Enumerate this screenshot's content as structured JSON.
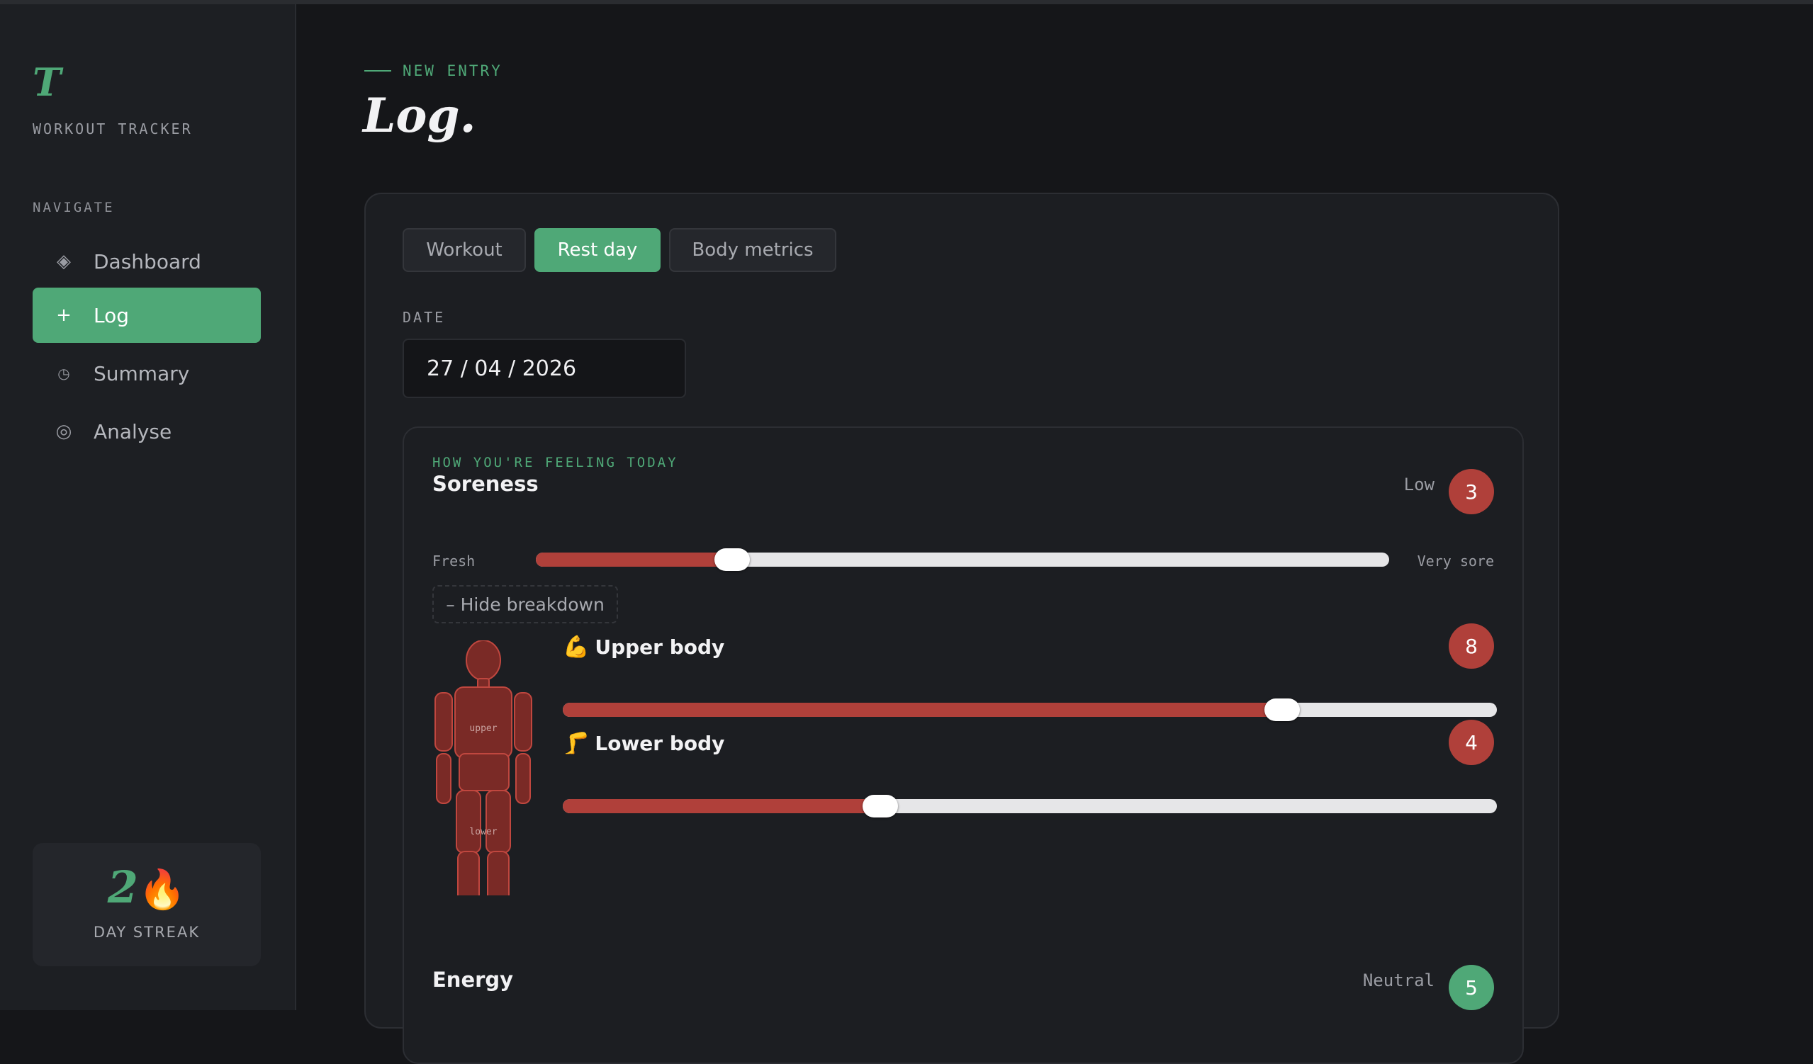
{
  "app": {
    "logo": "T",
    "name": "WORKOUT TRACKER"
  },
  "nav": {
    "title": "NAVIGATE",
    "items": [
      {
        "label": "Dashboard",
        "icon": "diamond-icon",
        "active": false
      },
      {
        "label": "Log",
        "icon": "plus-icon",
        "active": true
      },
      {
        "label": "Summary",
        "icon": "clock-icon",
        "active": false
      },
      {
        "label": "Analyse",
        "icon": "target-icon",
        "active": false
      }
    ]
  },
  "streak": {
    "value": "2",
    "icon": "fire-icon",
    "label": "DAY STREAK"
  },
  "page": {
    "eyebrow": "NEW ENTRY",
    "title": "Log."
  },
  "tabs": [
    {
      "label": "Workout",
      "active": false
    },
    {
      "label": "Rest day",
      "active": true
    },
    {
      "label": "Body metrics",
      "active": false
    }
  ],
  "date": {
    "label": "DATE",
    "value": "27 / 04 / 2026"
  },
  "feeling": {
    "title": "HOW YOU'RE FEELING TODAY",
    "soreness": {
      "name": "Soreness",
      "status": "Low",
      "value": "3",
      "min_label": "Fresh",
      "max_label": "Very sore",
      "level": 0.23,
      "toggle_label": "– Hide breakdown",
      "figure_labels": {
        "upper": "upper",
        "lower": "lower"
      },
      "parts": [
        {
          "emoji": "💪",
          "name": "Upper body",
          "value": "8",
          "level": 0.77
        },
        {
          "emoji": "🦵",
          "name": "Lower body",
          "value": "4",
          "level": 0.34
        }
      ]
    },
    "energy": {
      "name": "Energy",
      "status": "Neutral",
      "value": "5"
    }
  },
  "colors": {
    "accent": "#4fa877",
    "soreness": "#b0403a",
    "background": "#151619",
    "sidebar": "#1d1f23"
  }
}
